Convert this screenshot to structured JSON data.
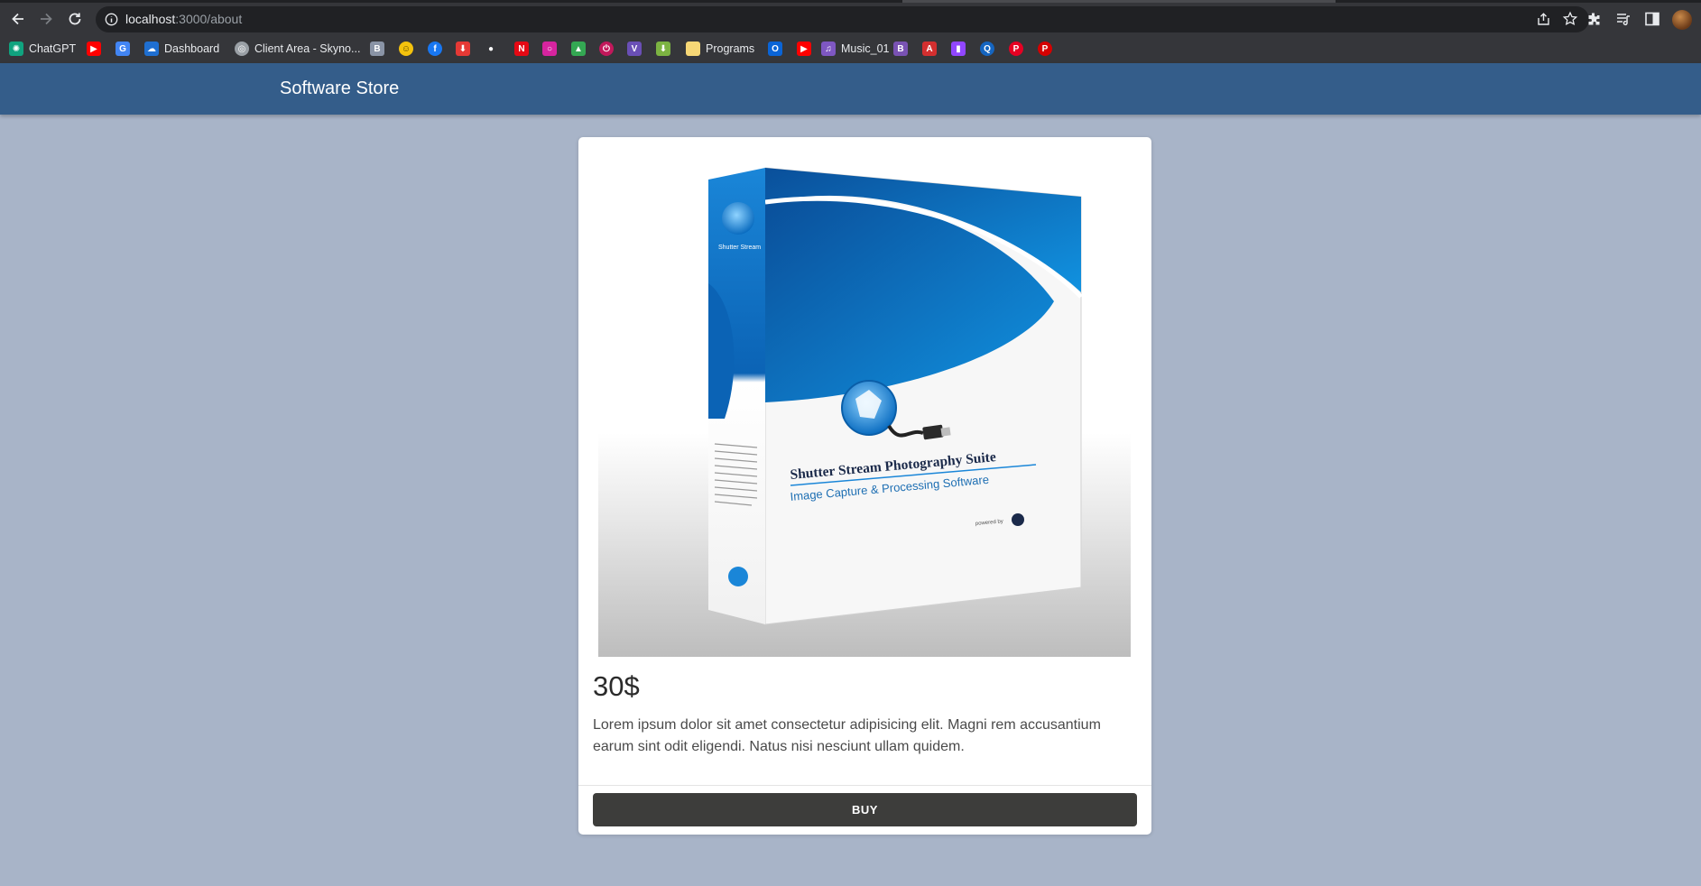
{
  "browser": {
    "url_host": "localhost",
    "url_path": ":3000/about",
    "bookmarks": [
      {
        "label": "ChatGPT",
        "icon": "chatgpt-icon",
        "color": "#10a37f"
      },
      {
        "label": "",
        "icon": "youtube-icon",
        "color": "#ff0000"
      },
      {
        "label": "",
        "icon": "translate-icon",
        "color": "#4285f4"
      },
      {
        "label": "Dashboard",
        "icon": "onedrive-icon",
        "color": "#1f6fd1"
      },
      {
        "label": "Client Area - Skyno...",
        "icon": "globe-icon",
        "color": "#9aa0a6"
      },
      {
        "label": "",
        "icon": "b-icon",
        "color": "#8a94a6"
      },
      {
        "label": "",
        "icon": "smiley-icon",
        "color": "#f4c20d"
      },
      {
        "label": "",
        "icon": "facebook-icon",
        "color": "#1877f2"
      },
      {
        "label": "",
        "icon": "download-icon",
        "color": "#e53935"
      },
      {
        "label": "",
        "icon": "github-icon",
        "color": "#ffffff"
      },
      {
        "label": "",
        "icon": "netflix-icon",
        "color": "#e50914"
      },
      {
        "label": "",
        "icon": "instagram-icon",
        "color": "#d6249f"
      },
      {
        "label": "",
        "icon": "drive-icon",
        "color": "#34a853"
      },
      {
        "label": "",
        "icon": "power-icon",
        "color": "#c2185b"
      },
      {
        "label": "",
        "icon": "v-icon",
        "color": "#6a4fb6"
      },
      {
        "label": "",
        "icon": "green-arrow-icon",
        "color": "#7cb342"
      },
      {
        "label": "Programs",
        "icon": "folder-icon",
        "color": "#f6d776"
      },
      {
        "label": "",
        "icon": "outlook-icon",
        "color": "#0a64d6"
      },
      {
        "label": "",
        "icon": "youtube-icon",
        "color": "#ff0000"
      },
      {
        "label": "Music_01",
        "icon": "music-icon",
        "color": "#7e57c2"
      },
      {
        "label": "",
        "icon": "bootstrap-icon",
        "color": "#7952b3"
      },
      {
        "label": "",
        "icon": "a-icon",
        "color": "#d32f2f"
      },
      {
        "label": "",
        "icon": "twitch-icon",
        "color": "#9146ff"
      },
      {
        "label": "",
        "icon": "q-icon",
        "color": "#1565c0"
      },
      {
        "label": "",
        "icon": "pinterest-icon",
        "color": "#e60023"
      },
      {
        "label": "",
        "icon": "p-icon",
        "color": "#d50000"
      }
    ]
  },
  "app": {
    "title": "Software Store"
  },
  "product": {
    "image_icon": "software-box-image",
    "price": "30$",
    "description": "Lorem ipsum dolor sit amet consectetur adipisicing elit. Magni rem accusantium earum sint odit eligendi. Natus nisi nesciunt ullam quidem.",
    "buy_label": "BUY",
    "box_title": "Shutter Stream Photography Suite",
    "box_subtitle": "Image Capture & Processing Software",
    "box_side_brand": "Shutter Stream",
    "box_powered": "powered by"
  },
  "colors": {
    "appbar": "#345d8a",
    "page_bg": "#a8b4c8",
    "buy_button": "#3d3d3b"
  }
}
